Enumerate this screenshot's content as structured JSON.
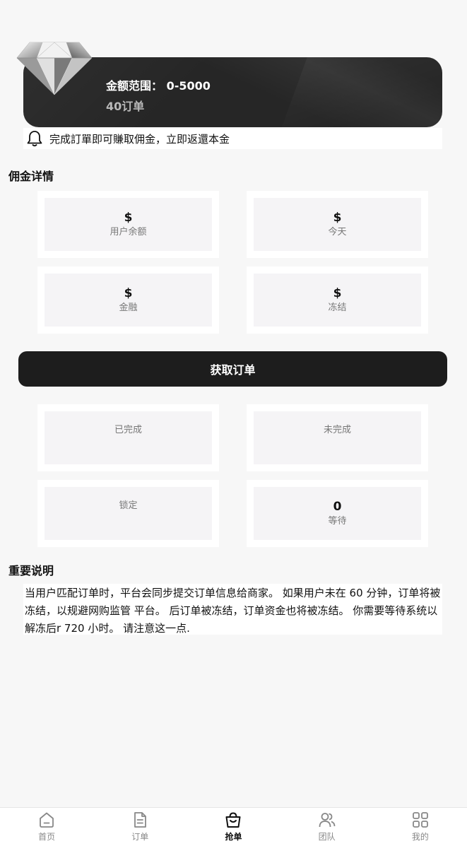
{
  "vip": {
    "range_label": "金额范围：",
    "range_value": "0-5000",
    "orders": "40订单"
  },
  "notice": {
    "text": "完成訂單即可賺取佣金，立即返還本金"
  },
  "commission": {
    "title": "佣金详情",
    "tiles": [
      {
        "value": "$",
        "label": "用户余额"
      },
      {
        "value": "$",
        "label": "今天"
      },
      {
        "value": "$",
        "label": "金融"
      },
      {
        "value": "$",
        "label": "冻结"
      }
    ]
  },
  "grab_button": "获取订单",
  "orders": {
    "tiles": [
      {
        "value": "",
        "label": "已完成"
      },
      {
        "value": "",
        "label": "未完成"
      },
      {
        "value": "",
        "label": "锁定"
      },
      {
        "value": "0",
        "label": "等待"
      }
    ]
  },
  "important": {
    "title": "重要说明",
    "text": "当用户匹配订单时，平台会同步提交订单信息给商家。 如果用户未在 60 分钟，订单将被冻结，以规避网购监管 平台。 后订单被冻结，订单资金也将被冻结。 你需要等待系统以解冻后r 720 小时。 请注意这一点."
  },
  "nav": {
    "items": [
      {
        "label": "首页",
        "icon": "home-icon"
      },
      {
        "label": "订单",
        "icon": "document-icon"
      },
      {
        "label": "抢单",
        "icon": "shopping-bag-icon",
        "active": true
      },
      {
        "label": "团队",
        "icon": "team-icon"
      },
      {
        "label": "我的",
        "icon": "grid-icon"
      }
    ]
  }
}
